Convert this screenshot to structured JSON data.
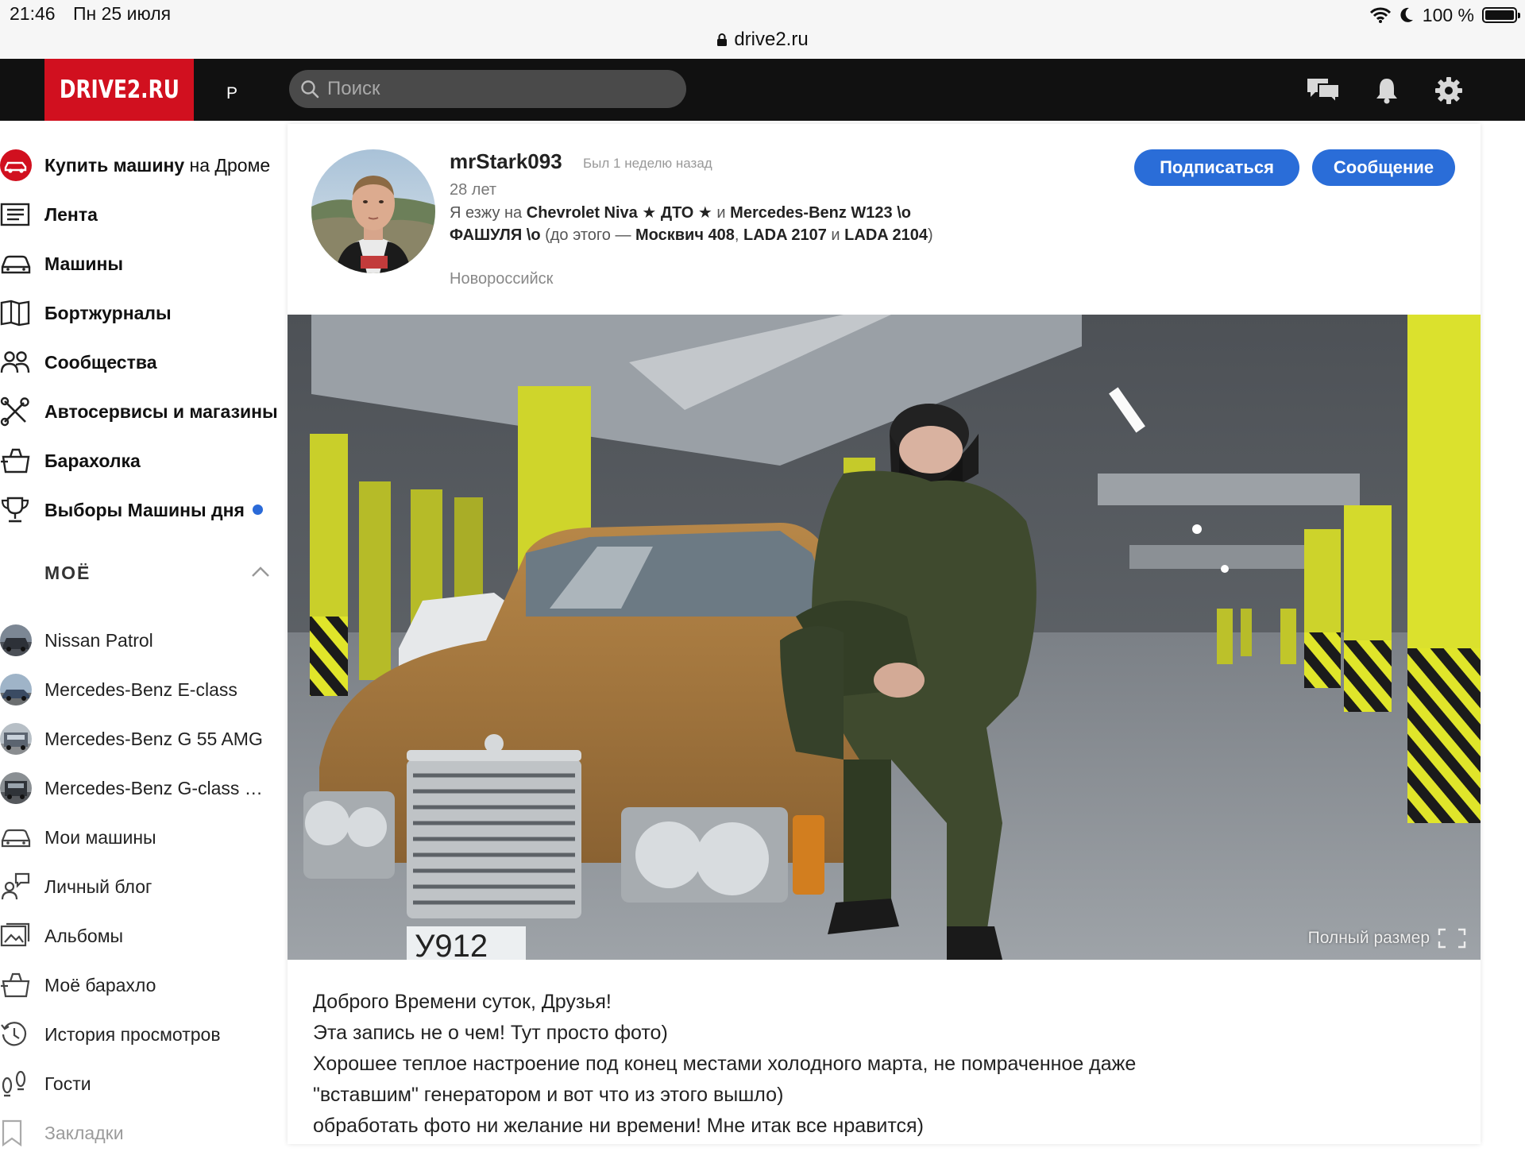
{
  "status_bar": {
    "time": "21:46",
    "date": "Пн 25 июля",
    "url": "drive2.ru",
    "battery": "100 %"
  },
  "header": {
    "logo": "DRIVE2.RU",
    "user_initial": "Р",
    "search_placeholder": "Поиск",
    "icons": [
      "messages-icon",
      "bell-icon",
      "gear-icon"
    ],
    "brand_color": "#d1101f"
  },
  "sidebar": {
    "main_items": [
      {
        "label_bold": "Купить машину",
        "label_light": " на Дроме",
        "icon": "drom-icon"
      },
      {
        "label": "Лента",
        "icon": "feed-icon"
      },
      {
        "label": "Машины",
        "icon": "car-icon"
      },
      {
        "label": "Бортжурналы",
        "icon": "logbook-icon"
      },
      {
        "label": "Сообщества",
        "icon": "people-icon"
      },
      {
        "label": "Автосервисы и магазины",
        "icon": "tools-icon"
      },
      {
        "label": "Барахолка",
        "icon": "market-icon"
      },
      {
        "label": "Выборы Машины дня",
        "icon": "trophy-icon",
        "badge_dot": true
      }
    ],
    "section_title": "МОЁ",
    "my_items": [
      {
        "label": "Nissan Patrol",
        "icon": "car-thumb"
      },
      {
        "label": "Mercedes-Benz E-class",
        "icon": "car-thumb"
      },
      {
        "label": "Mercedes-Benz G 55 AMG",
        "icon": "car-thumb"
      },
      {
        "label": "Mercedes-Benz G-class …",
        "icon": "car-thumb"
      },
      {
        "label": "Мои машины",
        "icon": "my-cars-icon"
      },
      {
        "label": "Личный блог",
        "icon": "blog-icon"
      },
      {
        "label": "Альбомы",
        "icon": "album-icon"
      },
      {
        "label": "Моё барахло",
        "icon": "my-market-icon"
      },
      {
        "label": "История просмотров",
        "icon": "history-icon"
      },
      {
        "label": "Гости",
        "icon": "footprints-icon"
      },
      {
        "label": "Закладки",
        "icon": "bookmark-icon"
      }
    ]
  },
  "profile": {
    "username": "mrStark093",
    "last_seen": "Был 1 неделю назад",
    "age": "28 лет",
    "bio": {
      "prefix": "Я езжу на ",
      "car1": "Chevrolet Niva ★ ДТО ★",
      "and": " и ",
      "car2": "Mercedes-Benz W123 \\о ФАШУЛЯ \\о",
      "before": " (до этого — ",
      "car3": "Москвич 408",
      "comma": ", ",
      "car4": "LADA 2107",
      "and2": " и ",
      "car5": "LADA 2104",
      "end": ")"
    },
    "city": "Новороссийск",
    "subscribe_button": "Подписаться",
    "message_button": "Сообщение",
    "button_color": "#2a6dd8"
  },
  "photo": {
    "fullsize_label": "Полный размер"
  },
  "post_text": [
    "Доброго Времени суток, Друзья!",
    "Эта запись не о чем! Тут просто фото)",
    "Хорошее теплое настроение под конец местами холодного марта, не помраченное даже",
    "\"вставшим\" генератором и вот что из этого вышло)",
    "обработать фото ни желание ни времени! Мне итак все нравится)"
  ]
}
